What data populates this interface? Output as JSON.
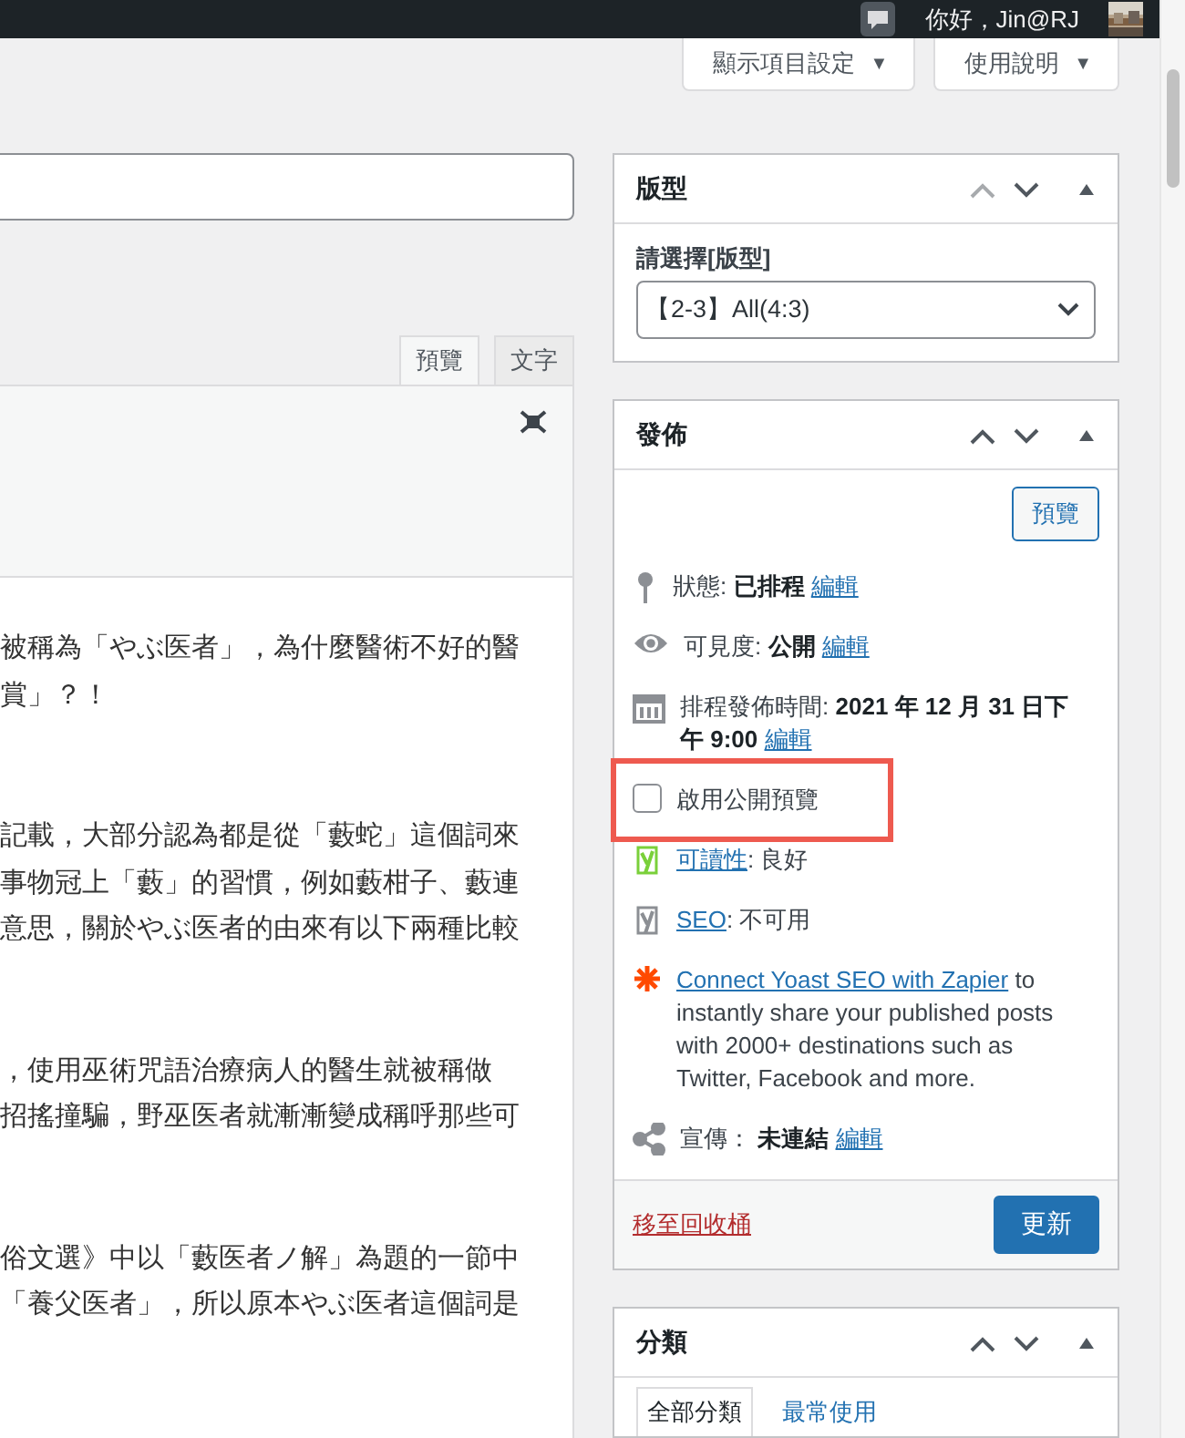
{
  "admin_bar": {
    "greeting": "你好，Jin@RJ"
  },
  "screen_buttons": [
    {
      "label": "顯示項目設定",
      "caret": "▼"
    },
    {
      "label": "使用說明",
      "caret": "▼"
    }
  ],
  "editor": {
    "tabs": [
      {
        "label": "預覽",
        "selected": true
      },
      {
        "label": "文字",
        "selected": false
      }
    ],
    "paragraphs": [
      [
        "被稱為「やぶ医者」，為什麼醫術不好的醫",
        "賞」？！"
      ],
      [
        "記載，大部分認為都是從「藪蛇」這個詞來",
        "事物冠上「藪」的習慣，例如藪柑子、藪連",
        "意思，關於やぶ医者的由來有以下兩種比較"
      ],
      [
        "，使用巫術咒語治療病人的醫生就被稱做",
        "招搖撞騙，野巫医者就漸漸變成稱呼那些可"
      ],
      [
        "俗文選》中以「藪医者ノ解」為題的一節中",
        "「養父医者」，所以原本やぶ医者這個詞是"
      ]
    ]
  },
  "template_box": {
    "title": "版型",
    "move_up_disabled": true,
    "label": "請選擇[版型]",
    "value": "【2-3】All(4:3)"
  },
  "publish_box": {
    "title": "發佈",
    "move_up_disabled": false,
    "preview_button": "預覽",
    "rows": [
      {
        "kind": "status",
        "label": "狀態:",
        "value": "已排程",
        "link": "編輯"
      },
      {
        "kind": "visibility",
        "label": "可見度:",
        "value": "公開",
        "link": "編輯"
      },
      {
        "kind": "schedule",
        "label": "排程發佈時間:",
        "value": "2021 年 12 月 31 日下午 9:00",
        "link": "編輯"
      },
      {
        "kind": "checkbox",
        "label": "啟用公開預覽",
        "checked": false,
        "highlighted": true
      },
      {
        "kind": "yoast",
        "color": "#7ad03a",
        "link": "可讀性",
        "value": ": 良好"
      },
      {
        "kind": "yoast",
        "color": "#8c8f94",
        "link": "SEO",
        "value": ": 不可用"
      },
      {
        "kind": "zapier",
        "link": "Connect Yoast SEO with Zapier",
        "text": " to instantly share your published posts with 2000+ destinations such as Twitter, Facebook and more."
      },
      {
        "kind": "share",
        "label": "宣傳：",
        "value": "未連結",
        "link": "編輯"
      }
    ],
    "trash_link": "移至回收桶",
    "update_button": "更新"
  },
  "category_box": {
    "title": "分類",
    "move_up_disabled": false,
    "tabs": [
      {
        "label": "全部分類",
        "selected": true
      },
      {
        "label": "最常使用",
        "selected": false
      }
    ]
  }
}
